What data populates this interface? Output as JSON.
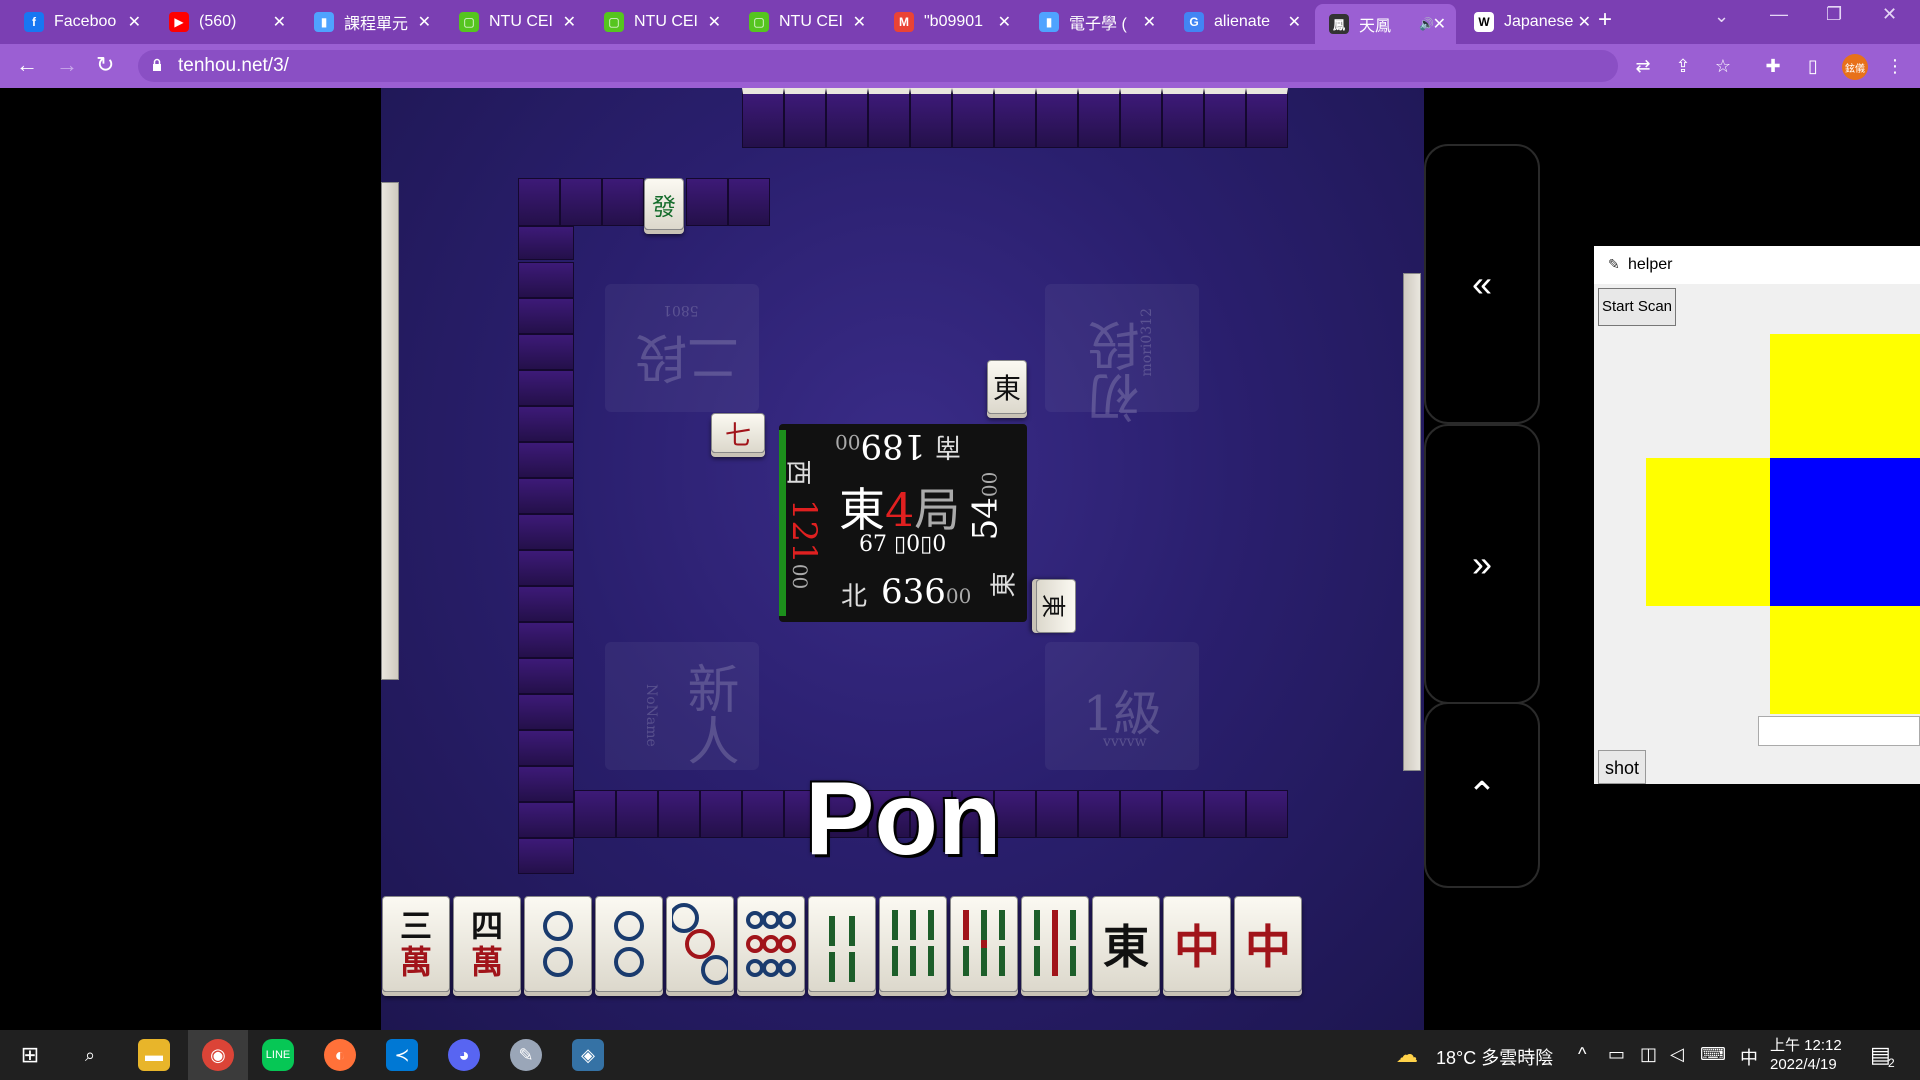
{
  "browser": {
    "tabs": [
      {
        "title": "Faceboo",
        "favicon": "facebook-icon",
        "color": "#1877f2",
        "glyph": "f"
      },
      {
        "title": "(560)",
        "favicon": "youtube-icon",
        "color": "#ff0000",
        "glyph": "▶"
      },
      {
        "title": "課程單元",
        "favicon": "chart-icon",
        "color": "#4fa3ff",
        "glyph": "▮"
      },
      {
        "title": "NTU CEI",
        "favicon": "ntu-icon",
        "color": "#55c51f",
        "glyph": "▢"
      },
      {
        "title": "NTU CEI",
        "favicon": "ntu-icon",
        "color": "#55c51f",
        "glyph": "▢"
      },
      {
        "title": "NTU CEI",
        "favicon": "ntu-icon",
        "color": "#55c51f",
        "glyph": "▢"
      },
      {
        "title": "\"b09901",
        "favicon": "gmail-icon",
        "color": "#ea4335",
        "glyph": "M"
      },
      {
        "title": "電子學 (",
        "favicon": "chart-icon",
        "color": "#4fa3ff",
        "glyph": "▮"
      },
      {
        "title": "alienate",
        "favicon": "google-icon",
        "color": "#4285f4",
        "glyph": "G"
      },
      {
        "title": "天鳳",
        "favicon": "tenhou-icon",
        "color": "#333333",
        "glyph": "鳳",
        "active": true,
        "audio": "🔊"
      },
      {
        "title": "Japanese",
        "favicon": "wikipedia-icon",
        "color": "#ffffff",
        "glyph": "W"
      }
    ],
    "url": "tenhou.net/3/",
    "profile_label": "鉉儀"
  },
  "game": {
    "center": {
      "round_wind": "東",
      "round_number": "4",
      "round_suffix": "局",
      "honba_line": "67 ▯0▯0",
      "seats": {
        "south": {
          "label": "南",
          "score": "189",
          "score_tail": "00"
        },
        "west": {
          "label": "西",
          "score": "121",
          "score_tail": "00"
        },
        "east": {
          "label": "東",
          "score": "54",
          "score_tail": "00"
        },
        "north": {
          "label": "北",
          "score": "636",
          "score_tail": "00"
        }
      }
    },
    "players": {
      "top_left": {
        "rank": "二段",
        "name": "5801"
      },
      "top_right": {
        "rank": "初段",
        "name": "mori0312"
      },
      "bottom_left": {
        "rank": "新人",
        "name": "NoName"
      },
      "bottom_right": {
        "rank": "1級",
        "name": "vvvvw"
      }
    },
    "discards": {
      "top_called": "發",
      "left": "七",
      "right_upper": "東",
      "right_lower": "東"
    },
    "call_text": "Pon",
    "hand": [
      {
        "num": "三",
        "suit": "萬",
        "kind": "man"
      },
      {
        "num": "四",
        "suit": "萬",
        "kind": "man"
      },
      {
        "num": "2",
        "suit": "筒",
        "kind": "pin"
      },
      {
        "num": "2",
        "suit": "筒",
        "kind": "pin"
      },
      {
        "num": "3",
        "suit": "筒",
        "kind": "pin"
      },
      {
        "num": "9",
        "suit": "筒",
        "kind": "pin"
      },
      {
        "num": "4",
        "suit": "索",
        "kind": "sou"
      },
      {
        "num": "6",
        "suit": "索",
        "kind": "sou"
      },
      {
        "num": "7",
        "suit": "索",
        "kind": "sou"
      },
      {
        "num": "8",
        "suit": "索",
        "kind": "sou"
      },
      {
        "num": "東",
        "suit": "",
        "kind": "honor"
      },
      {
        "num": "中",
        "suit": "",
        "kind": "honor-red"
      },
      {
        "num": "中",
        "suit": "",
        "kind": "honor-red"
      }
    ]
  },
  "side_buttons": {
    "rewind": "«",
    "forward": "»",
    "up": "⌃"
  },
  "helper": {
    "title": "helper",
    "scan_label": "Start Scan",
    "shot_label": "shot"
  },
  "taskbar": {
    "weather": "18°C 多雲時陰",
    "ime": "中",
    "time": "上午 12:12",
    "date": "2022/4/19",
    "notif_count": "2"
  }
}
